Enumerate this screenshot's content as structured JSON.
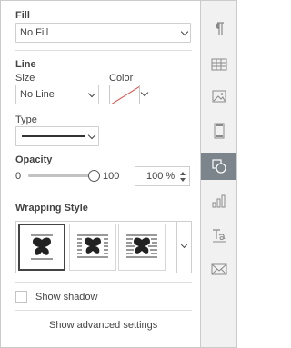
{
  "fill": {
    "header": "Fill",
    "value": "No Fill"
  },
  "line": {
    "header": "Line",
    "size_label": "Size",
    "size_value": "No Line",
    "color_label": "Color",
    "type_label": "Type"
  },
  "opacity": {
    "header": "Opacity",
    "min_label": "0",
    "max_label": "100",
    "value": 100,
    "value_text": "100 %"
  },
  "wrapping": {
    "header": "Wrapping Style",
    "items": [
      {
        "name": "inline",
        "selected": true
      },
      {
        "name": "square",
        "selected": false
      },
      {
        "name": "tight",
        "selected": false
      }
    ]
  },
  "shadow": {
    "label": "Show shadow",
    "checked": false
  },
  "advanced_link": "Show advanced settings",
  "sidebar": {
    "items": [
      {
        "icon": "paragraph-icon",
        "active": false
      },
      {
        "icon": "table-icon",
        "active": false
      },
      {
        "icon": "image-icon",
        "active": false
      },
      {
        "icon": "header-footer-icon",
        "active": false
      },
      {
        "icon": "shape-icon",
        "active": true
      },
      {
        "icon": "chart-icon",
        "active": false
      },
      {
        "icon": "text-art-icon",
        "active": false
      },
      {
        "icon": "mail-merge-icon",
        "active": false
      }
    ]
  },
  "colors": {
    "sidebar_active": "#7d858c",
    "no_color_slash": "#d9534f"
  }
}
